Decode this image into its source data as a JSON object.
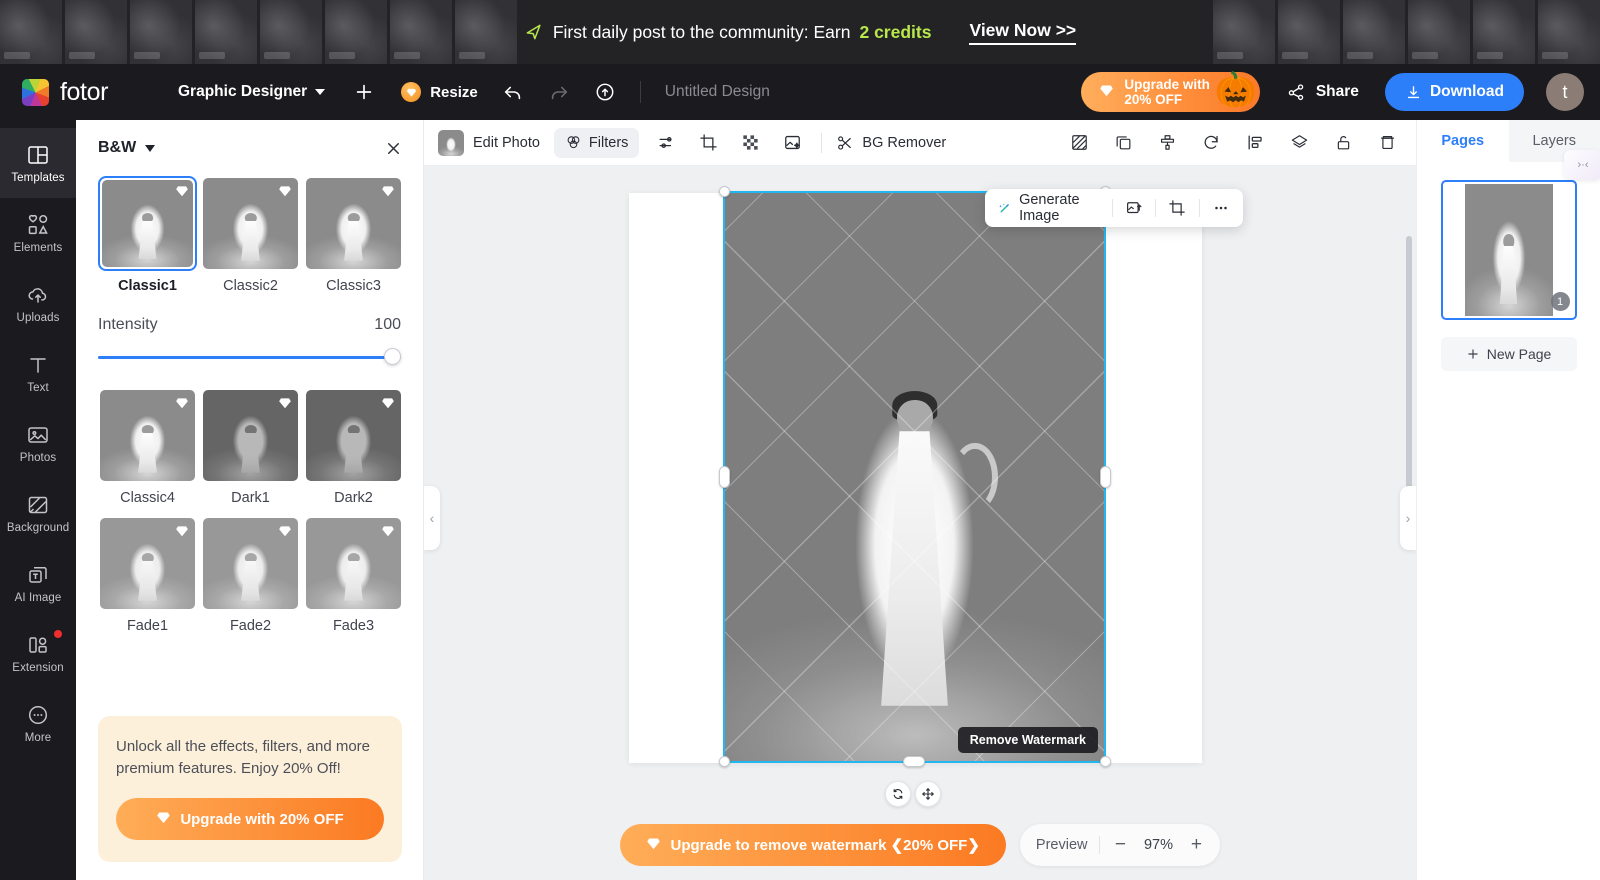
{
  "banner": {
    "icon": "rocket-icon",
    "message_prefix": "First daily post to the community: Earn ",
    "credits": "2 credits",
    "cta": "View Now >>"
  },
  "header": {
    "logo_text": "fotor",
    "workspace": "Graphic Designer",
    "add_icon": "plus-icon",
    "resize_label": "Resize",
    "undo_icon": "undo-icon",
    "redo_icon": "redo-icon",
    "upload_icon": "cloud-upload-icon",
    "design_title": "Untitled Design",
    "upgrade_line1": "Upgrade with",
    "upgrade_line2": "20% OFF",
    "upgrade_emoji": "🎃",
    "share_label": "Share",
    "download_label": "Download",
    "avatar_initial": "t"
  },
  "sidebar": {
    "items": [
      {
        "label": "Templates",
        "icon": "templates-icon",
        "active": true,
        "badge": false
      },
      {
        "label": "Elements",
        "icon": "elements-icon",
        "active": false,
        "badge": false
      },
      {
        "label": "Uploads",
        "icon": "uploads-icon",
        "active": false,
        "badge": false
      },
      {
        "label": "Text",
        "icon": "text-icon",
        "active": false,
        "badge": false
      },
      {
        "label": "Photos",
        "icon": "photos-icon",
        "active": false,
        "badge": false
      },
      {
        "label": "Background",
        "icon": "background-icon",
        "active": false,
        "badge": false
      },
      {
        "label": "AI Image",
        "icon": "ai-image-icon",
        "active": false,
        "badge": false
      },
      {
        "label": "Extension",
        "icon": "extension-icon",
        "active": false,
        "badge": true
      },
      {
        "label": "More",
        "icon": "more-icon",
        "active": false,
        "badge": false
      }
    ]
  },
  "filter_panel": {
    "category": "B&W",
    "close_icon": "close-icon",
    "filters_row1": [
      {
        "name": "Classic1",
        "selected": true,
        "premium": true,
        "style": ""
      },
      {
        "name": "Classic2",
        "selected": false,
        "premium": true,
        "style": ""
      },
      {
        "name": "Classic3",
        "selected": false,
        "premium": true,
        "style": ""
      }
    ],
    "filters_row2": [
      {
        "name": "Classic4",
        "selected": false,
        "premium": true,
        "style": ""
      },
      {
        "name": "Dark1",
        "selected": false,
        "premium": true,
        "style": "dark"
      },
      {
        "name": "Dark2",
        "selected": false,
        "premium": true,
        "style": "dark"
      }
    ],
    "filters_row3": [
      {
        "name": "Fade1",
        "selected": false,
        "premium": true,
        "style": "fade"
      },
      {
        "name": "Fade2",
        "selected": false,
        "premium": true,
        "style": "fade"
      },
      {
        "name": "Fade3",
        "selected": false,
        "premium": true,
        "style": "fade"
      }
    ],
    "intensity_label": "Intensity",
    "intensity_value": "100",
    "intensity_percent": 100,
    "promo_text": "Unlock all the effects, filters, and more premium features. Enjoy 20% Off!",
    "promo_button": "Upgrade with 20% OFF"
  },
  "editor_toolbar": {
    "edit_photo": "Edit Photo",
    "filters_tab": "Filters",
    "adjust_icon": "adjust-sliders-icon",
    "crop_icon": "crop-icon",
    "transparency_icon": "checkerboard-icon",
    "enhance_icon": "image-enhance-icon",
    "bg_remover": "BG Remover",
    "right_icons": [
      "transparency-icon",
      "duplicate-icon",
      "format-painter-icon",
      "rotate-icon",
      "align-icon",
      "layers-icon",
      "lock-icon",
      "delete-icon"
    ]
  },
  "context_toolbar": {
    "generate_image": "Generate Image",
    "replace_icon": "replace-image-icon",
    "crop_icon": "crop-icon",
    "more_icon": "more-dots-icon"
  },
  "canvas": {
    "watermark_badge": "Remove Watermark",
    "rotate_handle_icon": "rotate-handle-icon",
    "move_handle_icon": "move-handle-icon",
    "left_collapse": "‹",
    "right_collapse": "›"
  },
  "bottom_bar": {
    "upgrade_watermark": "Upgrade to remove watermark ❮20% OFF❯",
    "preview_label": "Preview",
    "zoom_out": "−",
    "zoom_level": "97%",
    "zoom_in": "+"
  },
  "right_panel": {
    "tabs": [
      {
        "label": "Pages",
        "active": true
      },
      {
        "label": "Layers",
        "active": false
      }
    ],
    "collapse_glyph": "›·‹",
    "page_number": "1",
    "new_page": "New Page"
  },
  "colors": {
    "accent_blue": "#2d7ff9",
    "selection_cyan": "#23b7ef",
    "upgrade_orange": "#fb7a22",
    "banner_green": "#b9e84a",
    "dark_chrome": "#1b1b1f",
    "canvas_gray": "#eef0f2"
  }
}
